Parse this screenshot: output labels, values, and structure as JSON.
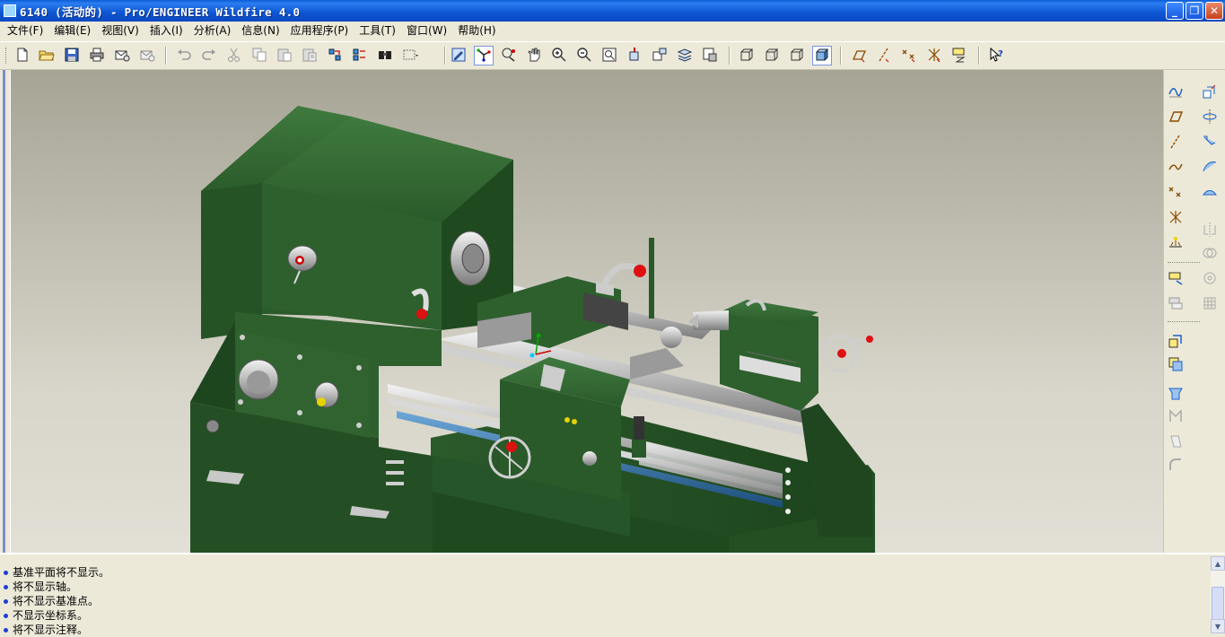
{
  "window": {
    "title": "6140 (活动的) - Pro/ENGINEER Wildfire 4.0",
    "buttons": [
      "minimize-icon",
      "restore-icon",
      "close-icon"
    ]
  },
  "menu": [
    {
      "label": "文件(F)"
    },
    {
      "label": "编辑(E)"
    },
    {
      "label": "视图(V)"
    },
    {
      "label": "插入(I)"
    },
    {
      "label": "分析(A)"
    },
    {
      "label": "信息(N)"
    },
    {
      "label": "应用程序(P)"
    },
    {
      "label": "工具(T)"
    },
    {
      "label": "窗口(W)"
    },
    {
      "label": "帮助(H)"
    }
  ],
  "toolbar": {
    "icons": [
      "new-icon",
      "open-icon",
      "save-icon",
      "print-icon",
      "send-mail-icon",
      "send-mail-attachment-icon",
      "undo-icon",
      "redo-icon",
      "cut-icon",
      "copy-icon",
      "paste-icon",
      "paste-special-icon",
      "regenerate-icon",
      "regeneration-manager-icon",
      "find-icon",
      "select-box-icon",
      "repaint-icon",
      "spin-center-icon",
      "orient-mode-icon",
      "pan-icon",
      "zoom-in-icon",
      "zoom-out-icon",
      "refit-icon",
      "reorient-icon",
      "saved-views-icon",
      "layers-icon",
      "view-manager-icon",
      "wireframe-icon",
      "hidden-line-icon",
      "no-hidden-icon",
      "shading-icon",
      "datum-planes-icon",
      "datum-axes-icon",
      "datum-points-icon",
      "coordinate-systems-icon",
      "annotations-icon",
      "context-help-icon"
    ],
    "pressed": [
      "spin-center-icon",
      "shading-icon"
    ]
  },
  "rightbar": {
    "icons": [
      "sketch-icon",
      "extrude-icon",
      "datum-plane-icon",
      "revolve-icon",
      "datum-axis-icon",
      "sweep-icon",
      "datum-curve-icon",
      "swept-blend-icon",
      "datum-point-icon",
      "boundary-blend-icon",
      "datum-csys-icon",
      "mirror-icon",
      "analysis-feature-icon",
      "merge-icon",
      "trim-icon",
      "pattern-icon",
      "offset-icon",
      "thicken-icon",
      "solidify-icon",
      "hole-icon",
      "shell-icon",
      "rib-icon",
      "draft-icon",
      "round-icon",
      "chamfer-icon"
    ]
  },
  "messages": [
    "基准平面将不显示。",
    "将不显示轴。",
    "将不显示基准点。",
    "不显示坐标系。",
    "将不显示注释。"
  ],
  "colors": {
    "titlebar": "#0a5bd6",
    "model_green": "#2f5f2f",
    "model_dark": "#1f4420",
    "accent_red": "#d11",
    "message_dot": "#1f3cd6"
  },
  "model": {
    "description_icon": "lathe-3d-model"
  }
}
